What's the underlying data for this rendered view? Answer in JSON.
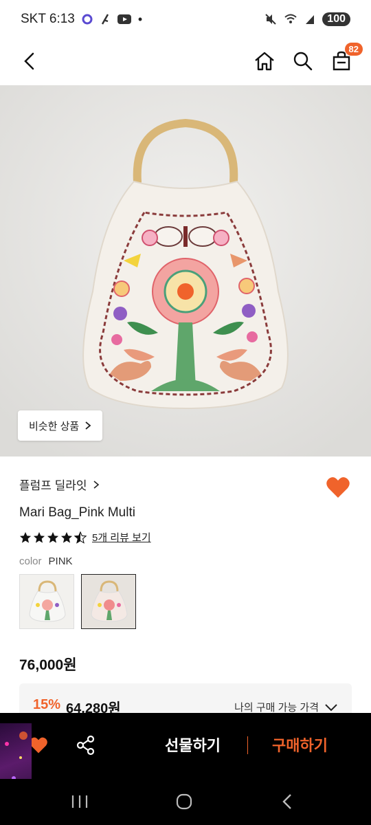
{
  "status_bar": {
    "carrier_time": "SKT 6:13",
    "battery": "100"
  },
  "top_nav": {
    "back_icon": "chevron-left-icon",
    "home_icon": "home-icon",
    "search_icon": "search-icon",
    "cart_icon": "shopping-bag-icon",
    "cart_badge": "82"
  },
  "hero": {
    "similar_button_label": "비슷한 상품"
  },
  "product": {
    "brand": "플럼프 딜라잇",
    "name": "Mari Bag_Pink Multi",
    "rating": 4.5,
    "review_link": "5개 리뷰 보기",
    "color_label": "color",
    "color_value": "PINK",
    "swatches": [
      "white-multi",
      "pink-multi"
    ],
    "selected_swatch": 1
  },
  "pricing": {
    "original_price": "76,000원",
    "discount": "15%",
    "sale_price": "64,280원",
    "my_price_label": "나의 구매 가능 가격"
  },
  "bottom_bar": {
    "gift_label": "선물하기",
    "buy_label": "구매하기"
  },
  "colors": {
    "accent": "#f0632b",
    "bottom_bar_bg": "#000000"
  }
}
